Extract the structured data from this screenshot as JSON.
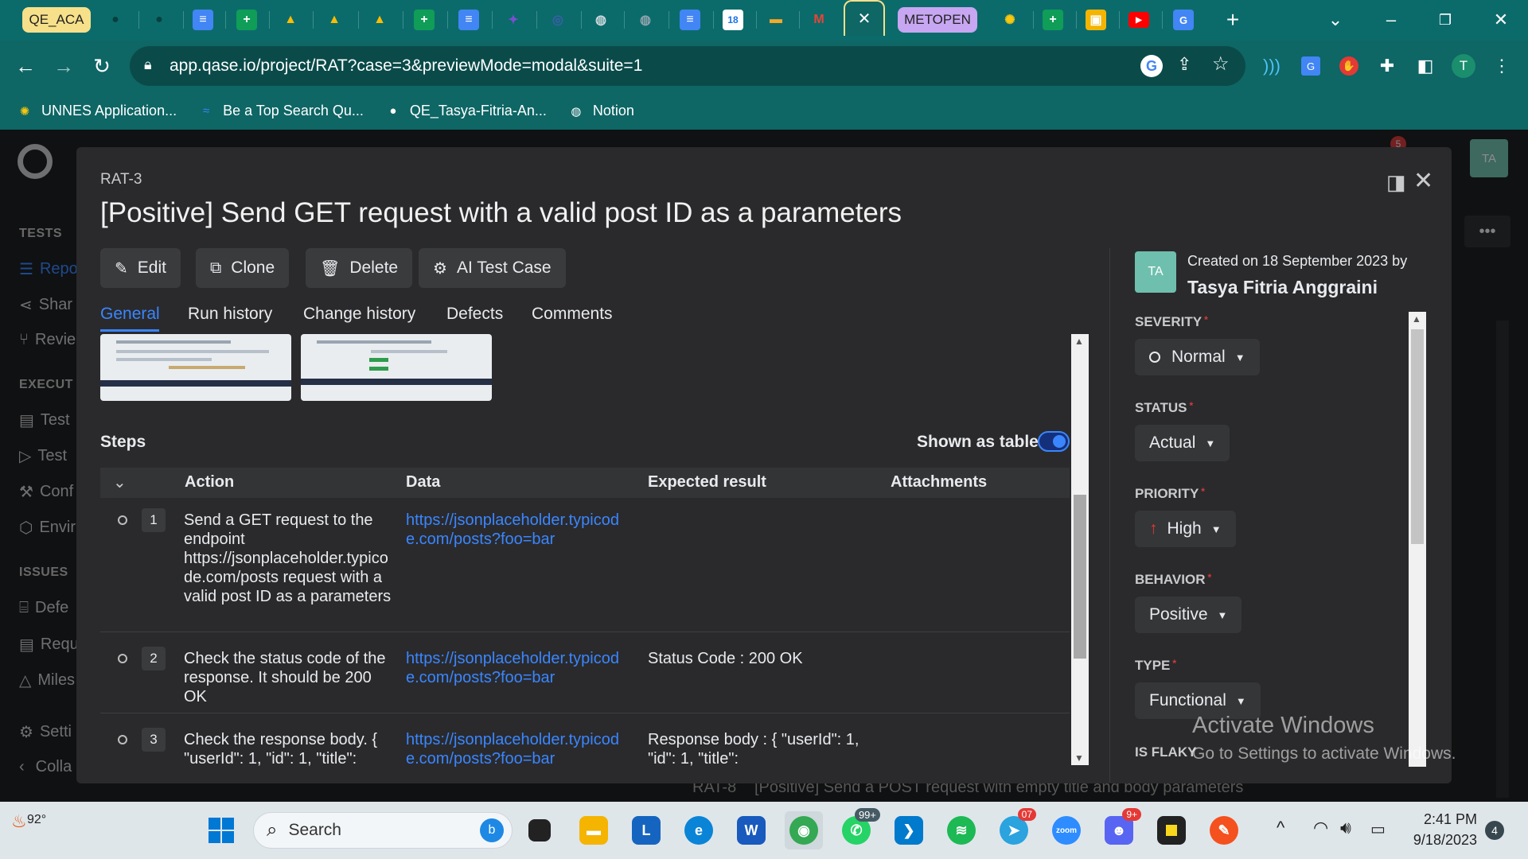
{
  "browser": {
    "tab_group_1": "QE_ACA",
    "tab_group_2": "METOPEN",
    "active_tab_close": "✕",
    "url": "app.qase.io/project/RAT?case=3&previewMode=modal&suite=1",
    "profile_initial": "T",
    "bookmarks": [
      {
        "label": "UNNES Application..."
      },
      {
        "label": "Be a Top Search Qu..."
      },
      {
        "label": "QE_Tasya-Fitria-An..."
      },
      {
        "label": "Notion"
      }
    ]
  },
  "sidebar": {
    "section_tests": "TESTS",
    "items_tests": [
      "Repo",
      "Shar",
      "Revie"
    ],
    "section_execution": "EXECUT",
    "items_execution": [
      "Test",
      "Test",
      "Conf",
      "Envir"
    ],
    "section_issues": "ISSUES",
    "items_issues": [
      "Defe",
      "Requ",
      "Miles"
    ],
    "settings": "Setti",
    "collapse": "Colla",
    "notif_count": "5"
  },
  "background_row": {
    "id": "RAT-8",
    "title": "[Positive] Send a POST request with empty title and body parameters"
  },
  "avatar_initials": "TA",
  "modal": {
    "case_id": "RAT-3",
    "title": "[Positive] Send GET request with a valid post ID as a parameters",
    "actions": {
      "edit": "Edit",
      "clone": "Clone",
      "delete": "Delete",
      "ai": "AI Test Case"
    },
    "tabs": [
      "General",
      "Run history",
      "Change history",
      "Defects",
      "Comments"
    ],
    "steps_title": "Steps",
    "shown_as_table": "Shown as table",
    "columns": {
      "action": "Action",
      "data": "Data",
      "expected": "Expected result",
      "attachments": "Attachments"
    },
    "steps": [
      {
        "num": "1",
        "action": "Send a GET request to the endpoint https://jsonplaceholder.typicode.com/posts request with a valid post ID as a parameters",
        "data": "https://jsonplaceholder.typicode.com/posts?foo=bar",
        "expected": ""
      },
      {
        "num": "2",
        "action": "Check the status code of the response. It should be 200 OK",
        "data": "https://jsonplaceholder.typicode.com/posts?foo=bar",
        "expected": "Status Code : 200 OK"
      },
      {
        "num": "3",
        "action": "Check the response body. { \"userId\": 1, \"id\": 1, \"title\":",
        "data": "https://jsonplaceholder.typicode.com/posts?foo=bar",
        "expected": "Response body : { \"userId\": 1, \"id\": 1, \"title\":"
      }
    ],
    "created_text": "Created on 18 September 2023 by",
    "author": "Tasya Fitria Anggraini",
    "fields": {
      "severity_label": "SEVERITY",
      "severity": "Normal",
      "status_label": "STATUS",
      "status": "Actual",
      "priority_label": "PRIORITY",
      "priority": "High",
      "behavior_label": "BEHAVIOR",
      "behavior": "Positive",
      "type_label": "TYPE",
      "type": "Functional",
      "flaky_label": "IS FLAKY"
    }
  },
  "watermark": {
    "title": "Activate Windows",
    "subtitle": "Go to Settings to activate Windows."
  },
  "taskbar": {
    "weather_temp": "92°",
    "search": "Search",
    "whatsapp_badge": "99+",
    "telegram_badge": "07",
    "discord_badge": "9+",
    "zoom": "zoom",
    "time": "2:41 PM",
    "date": "9/18/2023",
    "notif_count": "4"
  },
  "colors": {
    "accent": "#3a86ff",
    "teal": "#0e6665",
    "required": "#d43b3b",
    "priority_high": "#e53935"
  }
}
